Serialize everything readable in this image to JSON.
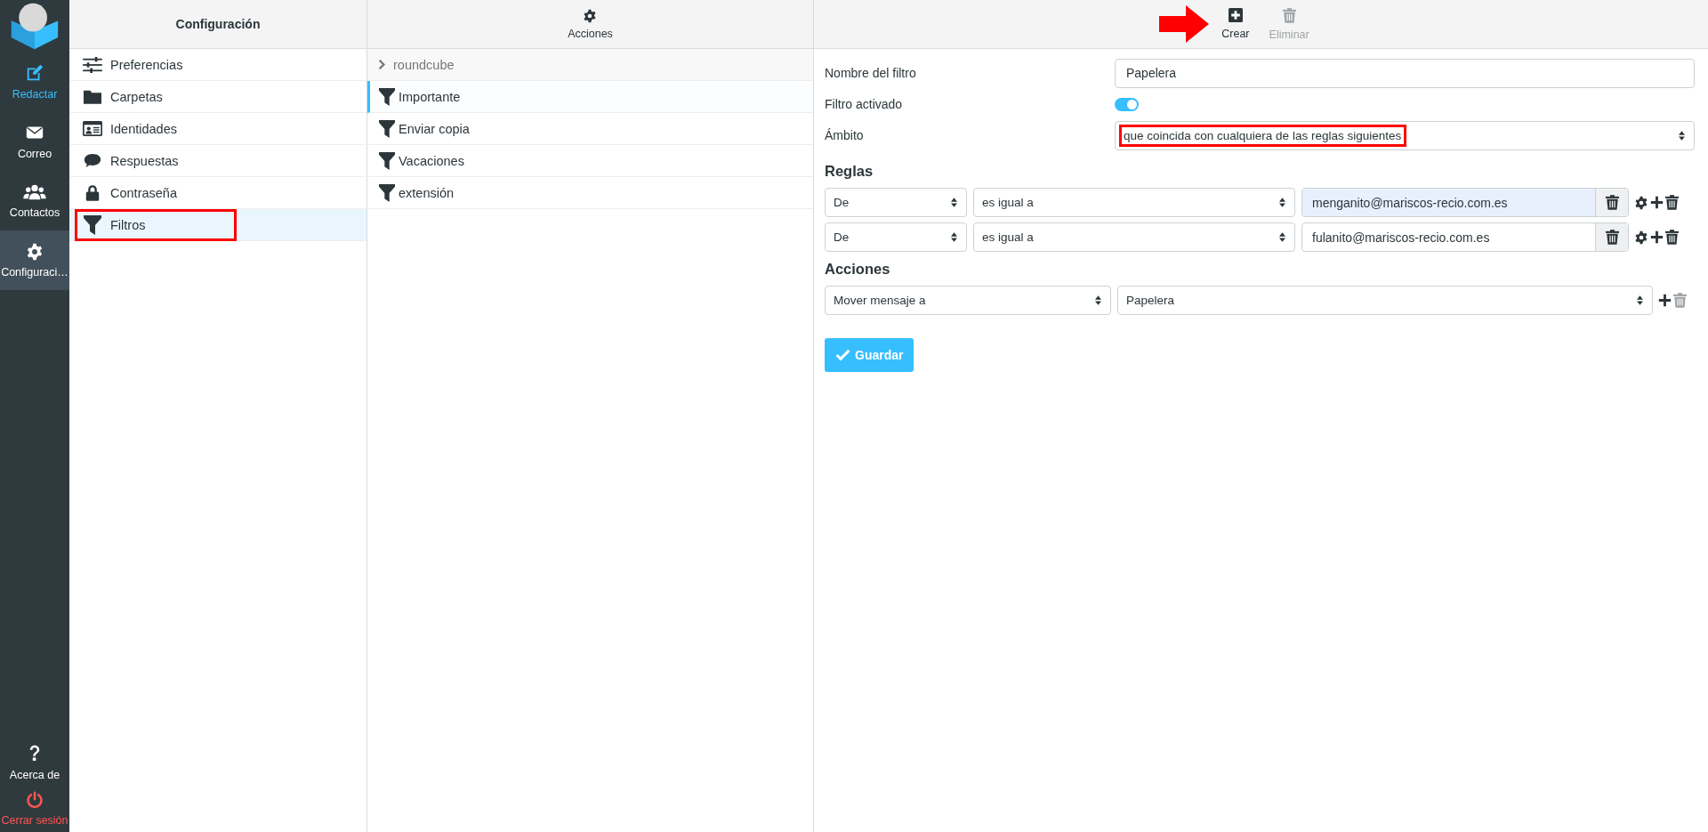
{
  "nav": {
    "items": [
      {
        "kind": "compose",
        "label": "Redactar",
        "color": "#37beff",
        "selected": false
      },
      {
        "kind": "mail",
        "label": "Correo",
        "color": "#ffffff",
        "selected": false
      },
      {
        "kind": "contacts",
        "label": "Contactos",
        "color": "#ffffff",
        "selected": false
      },
      {
        "kind": "settings",
        "label": "Configuraci…",
        "color": "#ffffff",
        "selected": true
      }
    ],
    "bottom": [
      {
        "kind": "about",
        "label": "Acerca de",
        "color": "#ffffff"
      },
      {
        "kind": "logout",
        "label": "Cerrar sesión",
        "color": "#ff5552"
      }
    ]
  },
  "settings": {
    "title": "Configuración",
    "items": [
      {
        "kind": "preferences",
        "label": "Preferencias",
        "selected": false,
        "highlighted": false
      },
      {
        "kind": "folders",
        "label": "Carpetas",
        "selected": false,
        "highlighted": false
      },
      {
        "kind": "identities",
        "label": "Identidades",
        "selected": false,
        "highlighted": false
      },
      {
        "kind": "responses",
        "label": "Respuestas",
        "selected": false,
        "highlighted": false
      },
      {
        "kind": "password",
        "label": "Contraseña",
        "selected": false,
        "highlighted": false
      },
      {
        "kind": "filters",
        "label": "Filtros",
        "selected": true,
        "highlighted": true
      }
    ]
  },
  "filters": {
    "menu_label": "Acciones",
    "set_label": "roundcube",
    "items": [
      {
        "label": "Importante",
        "focused": true
      },
      {
        "label": "Enviar copia",
        "focused": false
      },
      {
        "label": "Vacaciones",
        "focused": false
      },
      {
        "label": "extensión",
        "focused": false
      }
    ]
  },
  "toolbar": {
    "buttons": [
      {
        "kind": "create",
        "label": "Crear",
        "disabled": false,
        "pointer_arrow": true
      },
      {
        "kind": "delete",
        "label": "Eliminar",
        "disabled": true,
        "pointer_arrow": false
      }
    ]
  },
  "form": {
    "name": {
      "label": "Nombre del filtro",
      "value": "Papelera"
    },
    "enabled": {
      "label": "Filtro activado",
      "on": true
    },
    "scope": {
      "label": "Ámbito",
      "value": "que coincida con cualquiera de las reglas siguientes",
      "highlighted": true
    },
    "rules_heading": "Reglas",
    "rules": [
      {
        "header": "De",
        "operator": "es igual a",
        "value": "menganito@mariscos-recio.com.es",
        "autofilled": true
      },
      {
        "header": "De",
        "operator": "es igual a",
        "value": "fulanito@mariscos-recio.com.es",
        "autofilled": false
      }
    ],
    "actions_heading": "Acciones",
    "actions": [
      {
        "type": "Mover mensaje a",
        "target": "Papelera",
        "delete_disabled": true
      }
    ],
    "save_label": "Guardar"
  }
}
